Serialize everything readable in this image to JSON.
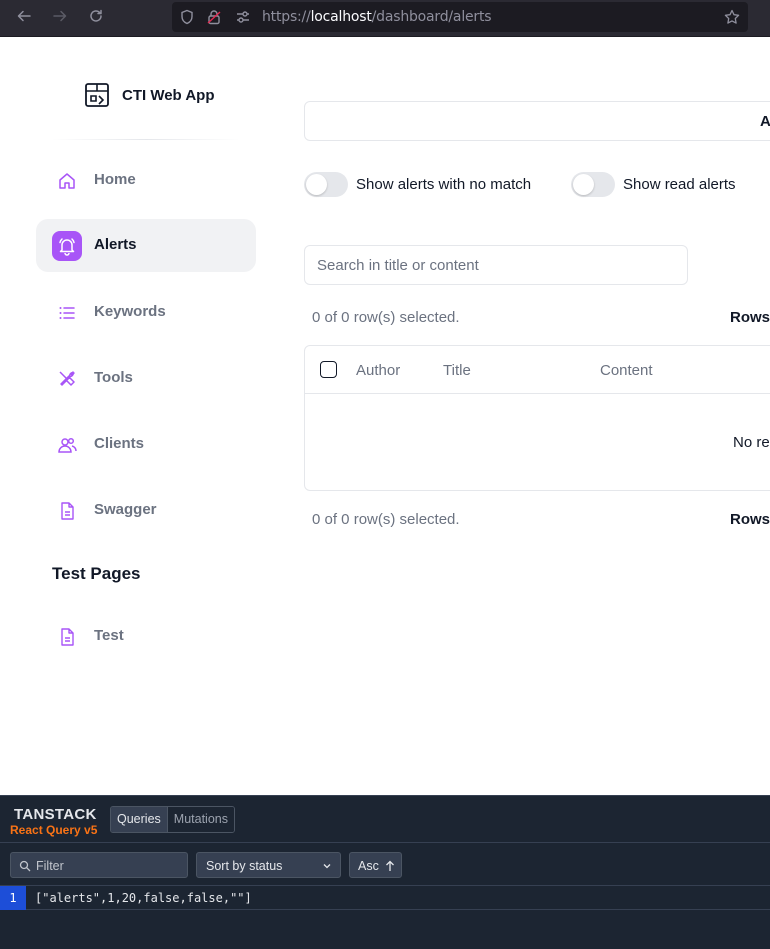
{
  "browser": {
    "url_scheme": "https://",
    "url_host": "localhost",
    "url_path": "/dashboard/alerts"
  },
  "sidebar": {
    "app_name": "CTI Web App",
    "items": [
      {
        "label": "Home",
        "icon": "home-icon",
        "active": false
      },
      {
        "label": "Alerts",
        "icon": "bell-icon",
        "active": true
      },
      {
        "label": "Keywords",
        "icon": "list-icon",
        "active": false
      },
      {
        "label": "Tools",
        "icon": "tools-icon",
        "active": false
      },
      {
        "label": "Clients",
        "icon": "users-icon",
        "active": false
      },
      {
        "label": "Swagger",
        "icon": "file-icon",
        "active": false
      }
    ],
    "section_title": "Test Pages",
    "test_items": [
      {
        "label": "Test",
        "icon": "file-icon"
      }
    ]
  },
  "main": {
    "top_box_text": "A",
    "toggle_no_match": "Show alerts with no match",
    "toggle_read": "Show read alerts",
    "search_placeholder": "Search in title or content",
    "selection_info_top": "0 of 0 row(s) selected.",
    "rows_label_top": "Rows",
    "columns": [
      "Author",
      "Title",
      "Content"
    ],
    "empty_text": "No res",
    "selection_info_bottom": "0 of 0 row(s) selected.",
    "rows_label_bottom": "Rows"
  },
  "devtools": {
    "brand_line1": "TANSTACK",
    "brand_line2": "React Query v5",
    "tabs": [
      "Queries",
      "Mutations"
    ],
    "filter_placeholder": "Filter",
    "sort_label": "Sort by status",
    "order_label": "Asc",
    "queries": [
      {
        "count": "1",
        "key": "[\"alerts\",1,20,false,false,\"\"]"
      }
    ]
  },
  "colors": {
    "accent": "#a855f7",
    "devtools_bg": "#1c2532",
    "devtools_brand": "#f97316",
    "query_count_bg": "#1d4ed8"
  }
}
